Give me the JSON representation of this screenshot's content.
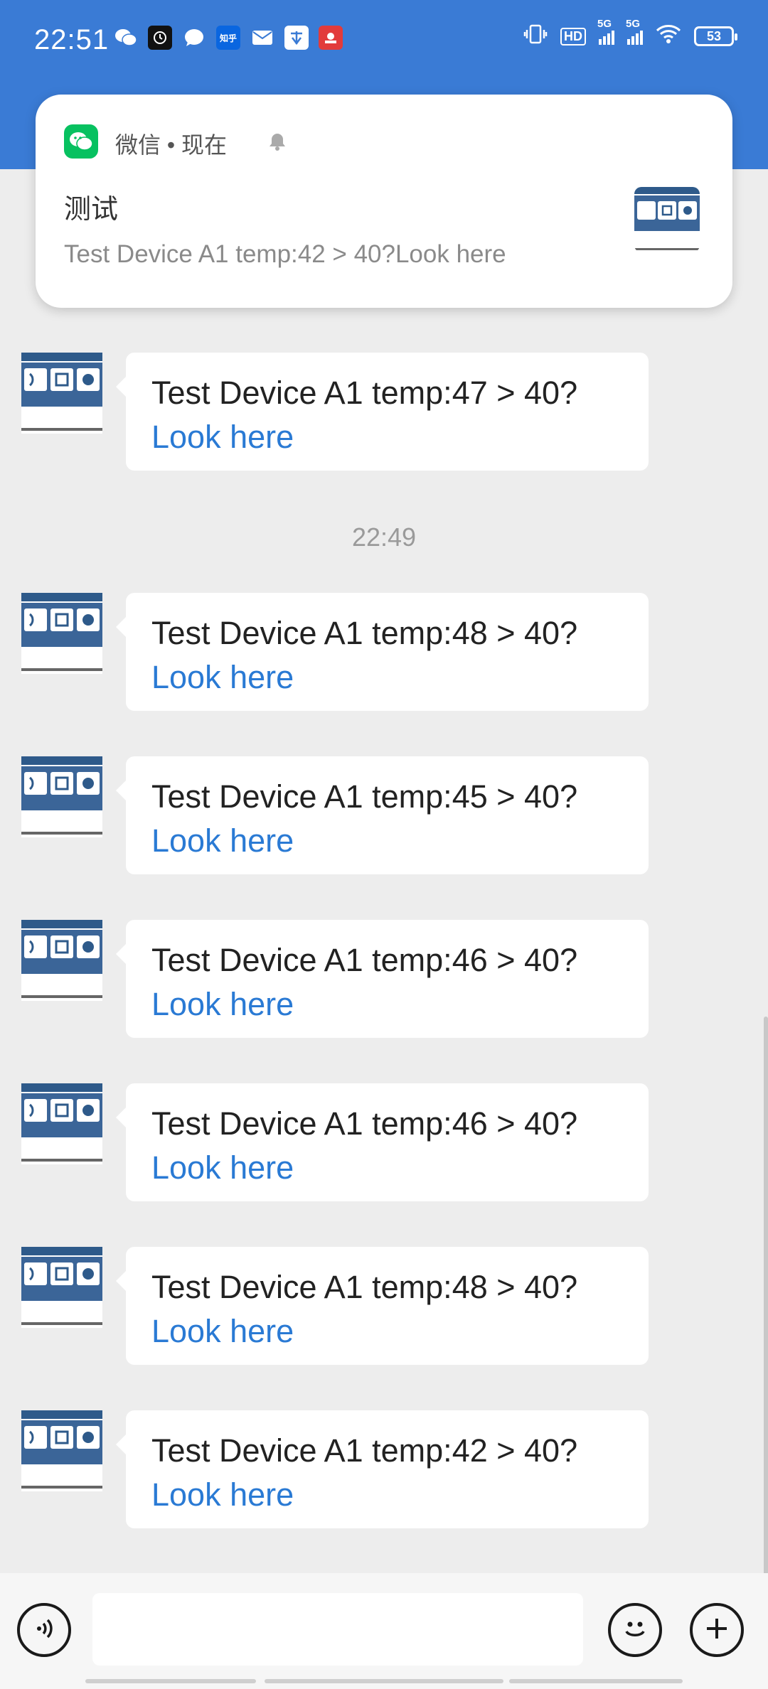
{
  "status_bar": {
    "time": "22:51",
    "notif_app_icons": [
      "wechat-icon",
      "clock-app-icon",
      "messages-icon",
      "zhihu-icon",
      "mail-icon",
      "app-icon",
      "weather-icon"
    ],
    "zhihu_label": "知乎",
    "signal_1": "5G",
    "signal_2": "5G",
    "hd_label": "HD",
    "battery": "53"
  },
  "notification": {
    "app_name": "微信 • 现在",
    "title": "测试",
    "body": "Test Device A1 temp:42 > 40?Look here"
  },
  "messages": [
    {
      "text": "Test Device A1 temp:47 > 40?",
      "link": "Look here"
    },
    {
      "text": "Test Device A1 temp:48 > 40?",
      "link": "Look here"
    },
    {
      "text": "Test Device A1 temp:45 > 40?",
      "link": "Look here"
    },
    {
      "text": "Test Device A1 temp:46 > 40?",
      "link": "Look here"
    },
    {
      "text": "Test Device A1 temp:46 > 40?",
      "link": "Look here"
    },
    {
      "text": "Test Device A1 temp:48 > 40?",
      "link": "Look here"
    },
    {
      "text": "Test Device A1 temp:42 > 40?",
      "link": "Look here"
    }
  ],
  "timestamp": "22:49",
  "colors": {
    "header": "#3a7bd5",
    "link": "#2a7ad4",
    "wechat_green": "#07c160"
  }
}
